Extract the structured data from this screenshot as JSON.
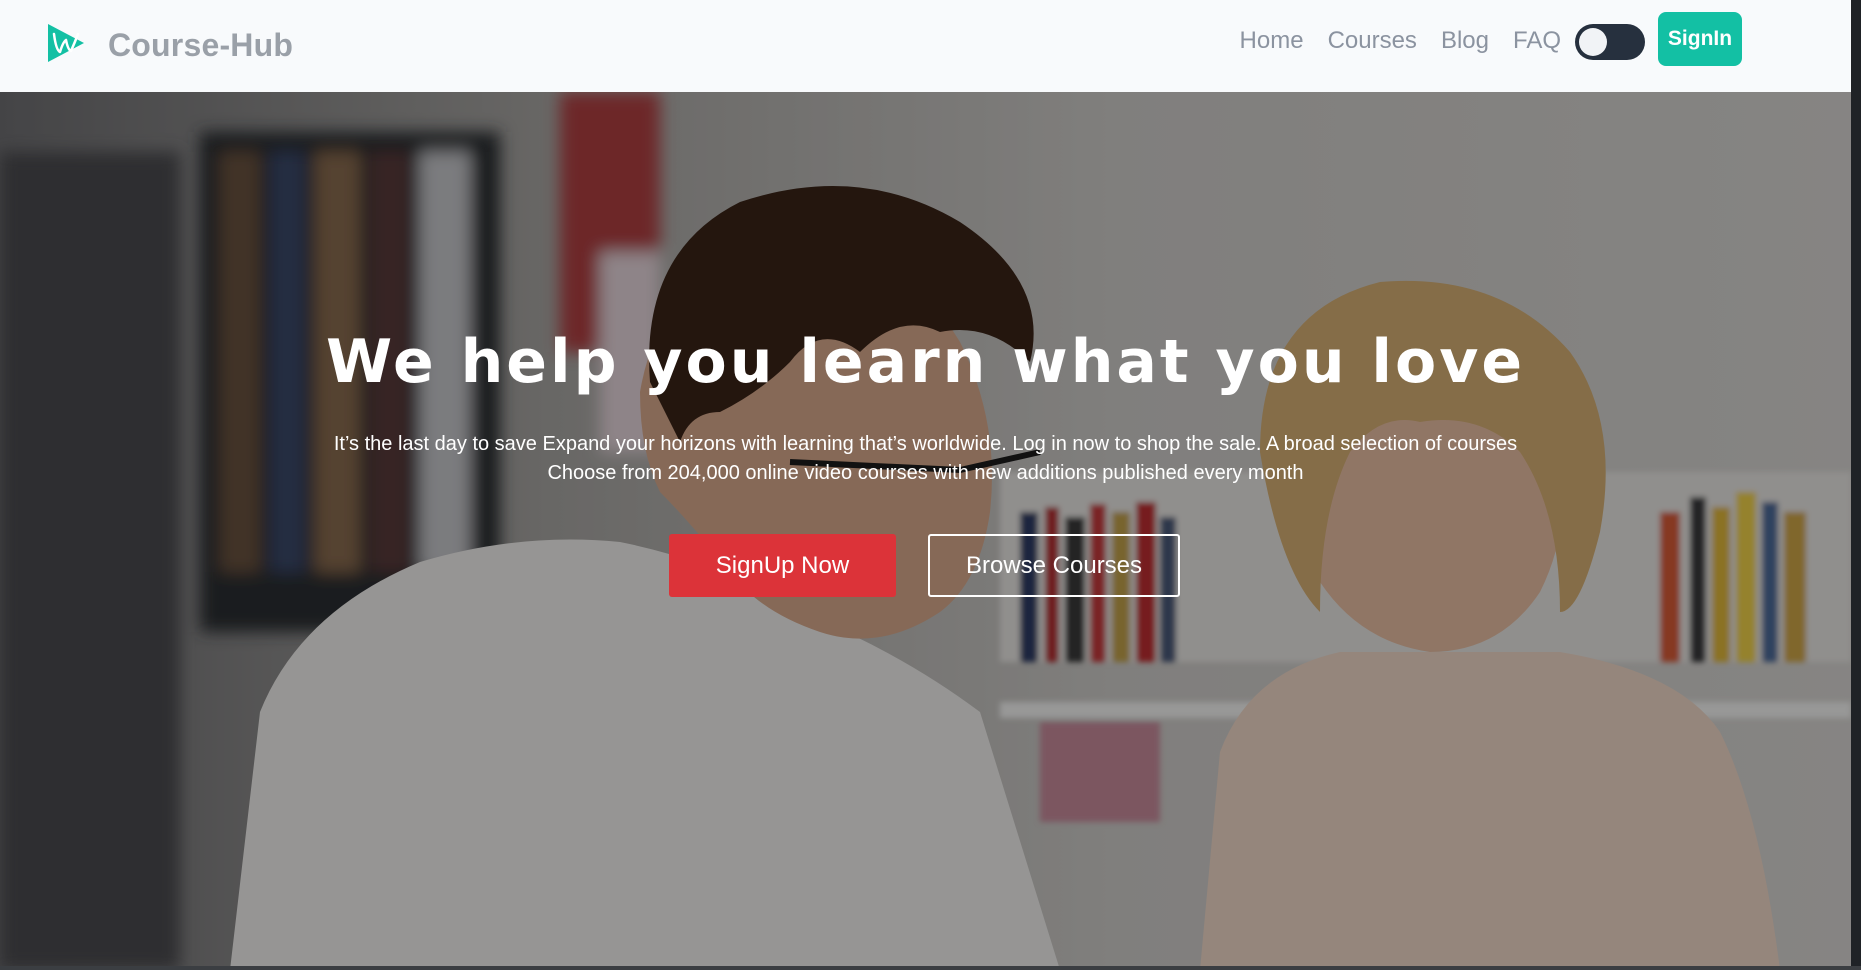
{
  "navbar": {
    "brand_name": "Course-Hub",
    "logo_icon": "play-w-logo-icon",
    "links": [
      "Home",
      "Courses",
      "Blog",
      "FAQ"
    ],
    "theme_toggle": {
      "state": "off",
      "icon": "toggle-switch-icon"
    },
    "signin_label": "SignIn"
  },
  "hero": {
    "title": "We help you learn what you love",
    "description": "It’s the last day to save Expand your horizons with learning that’s worldwide. Log in now to shop the sale. A broad selection of courses Choose from 204,000 online video courses with new additions published every month",
    "primary_button": "SignUp Now",
    "secondary_button": "Browse Courses"
  },
  "colors": {
    "accent": "#13c0a4",
    "cta_red": "#dc3339",
    "toggle_dark": "#26303e",
    "nav_text": "#8b93a0"
  }
}
